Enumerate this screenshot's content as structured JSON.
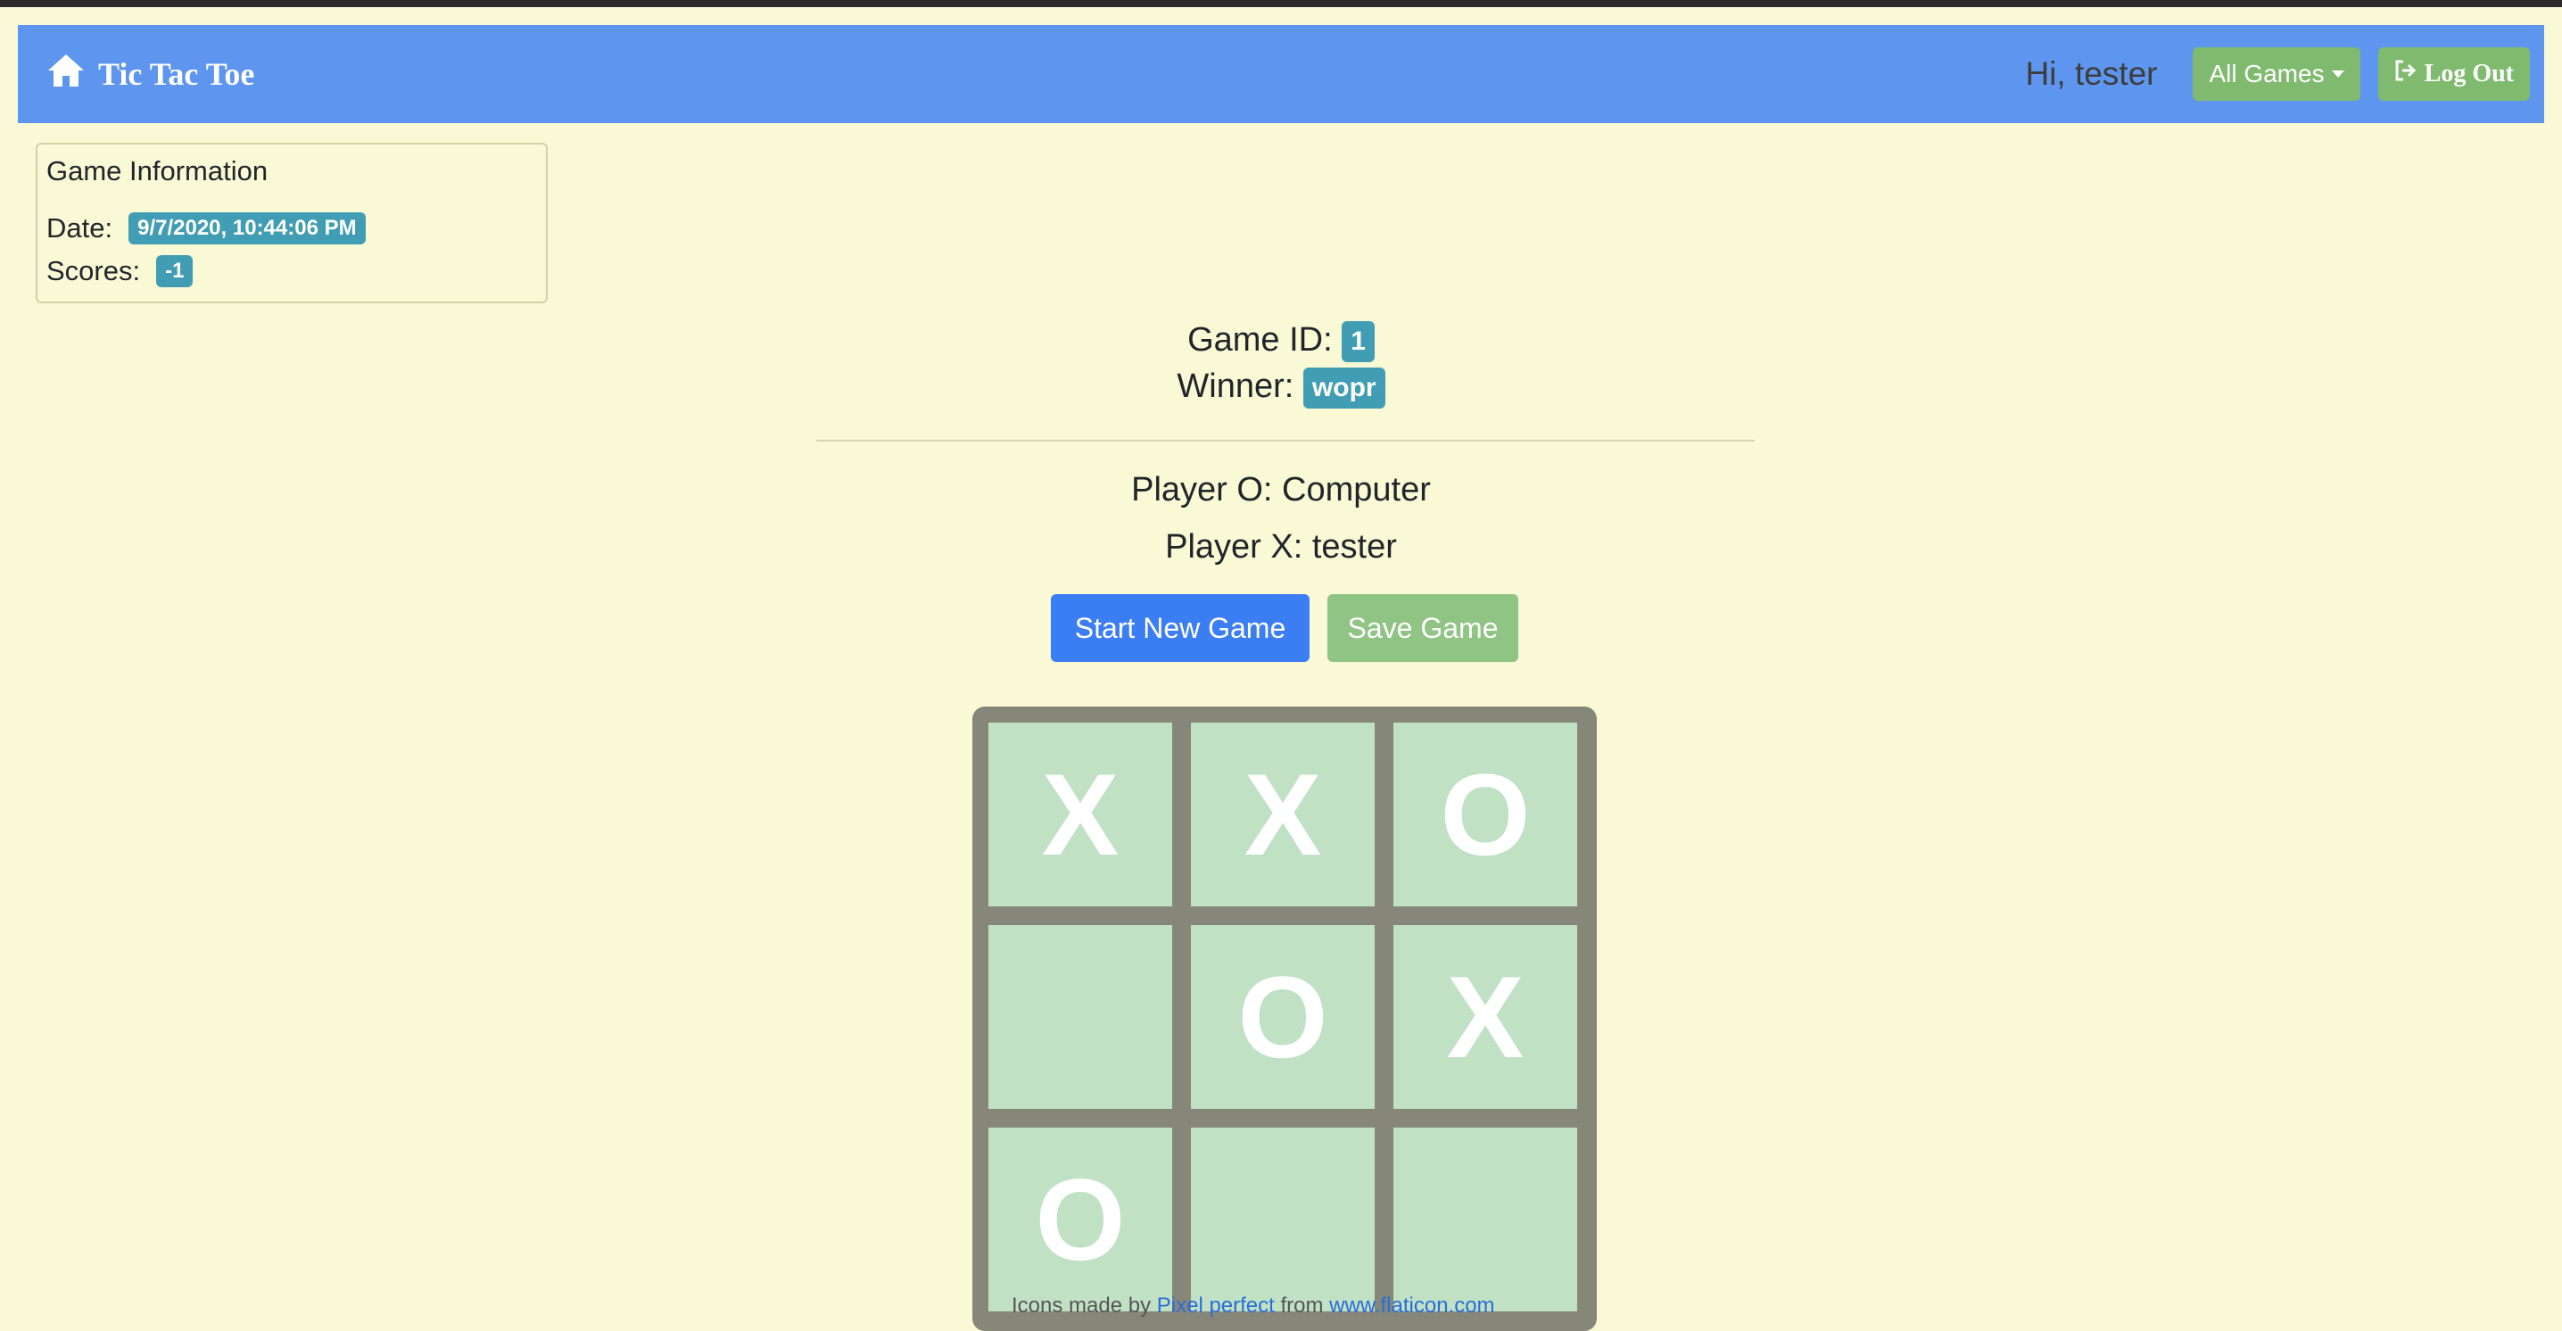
{
  "navbar": {
    "brand": "Tic Tac Toe",
    "greeting": "Hi, tester",
    "all_games_label": "All Games",
    "logout_label": "Log Out"
  },
  "info": {
    "title": "Game Information",
    "date_label": "Date:",
    "date_value": "9/7/2020, 10:44:06 PM",
    "scores_label": "Scores:",
    "scores_value": "-1"
  },
  "game": {
    "id_label": "Game ID:",
    "id_value": "1",
    "winner_label": "Winner:",
    "winner_value": "wopr",
    "player_o": "Player O: Computer",
    "player_x": "Player X: tester"
  },
  "actions": {
    "start_label": "Start New Game",
    "save_label": "Save Game"
  },
  "board": {
    "cells": [
      "X",
      "X",
      "O",
      "",
      "O",
      "X",
      "O",
      "",
      ""
    ]
  },
  "footer": {
    "prefix": "Icons made by ",
    "author": "Pixel perfect",
    "from": " from ",
    "site": "www.flaticon.com"
  },
  "colors": {
    "background": "#f9f9d6",
    "navbar": "#5e95ee",
    "badge": "#419db4",
    "primary": "#3b7df3",
    "success": "#7fba6f",
    "cell": "#c1e1c5",
    "board": "#878779"
  },
  "icons": {
    "brand": "home-icon",
    "logout": "sign-out-icon"
  }
}
